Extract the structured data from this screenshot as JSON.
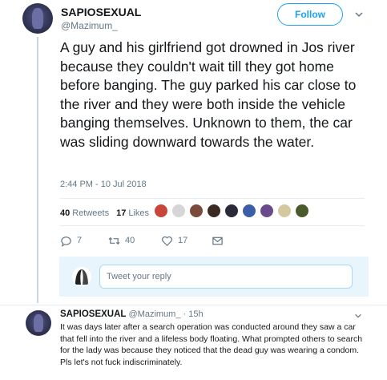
{
  "tweet": {
    "display_name": "SAPIOSEXUAL",
    "handle": "@Mazimum_",
    "follow_label": "Follow",
    "text": "A guy and his girlfriend got drowned in Jos river because they couldn't wait till they got home before banging. The guy parked his car close to the river and they were both inside the vehicle banging themselves. Unknown to them, the car was sliding downward towards the water.",
    "timestamp": "2:44 PM - 10 Jul 2018",
    "stats": {
      "retweets_count": "40",
      "retweets_label": "Retweets",
      "likes_count": "17",
      "likes_label": "Likes"
    },
    "actions": {
      "reply_count": "7",
      "retweet_count": "40",
      "like_count": "17"
    }
  },
  "reply_box": {
    "placeholder": "Tweet your reply"
  },
  "reply": {
    "display_name": "SAPIOSEXUAL",
    "handle": "@Mazimum_",
    "separator": "·",
    "time": "15h",
    "text": "It was days later after a search operation was conducted around they saw a car that fell into the river and a lifeless body floating. What prompted others to search for the lady was because they noticed that the dead guy was wearing a condom. Pls let's not fuck indiscriminately.",
    "reply_count": "",
    "retweet_count": "",
    "like_count": ""
  },
  "colors": {
    "accent": "#1da1f2",
    "secondary_text": "#657786",
    "reply_box_bg": "#e8f5fd"
  },
  "icons": [
    "chevron-down-icon",
    "reply-icon",
    "retweet-icon",
    "like-icon",
    "message-icon"
  ]
}
